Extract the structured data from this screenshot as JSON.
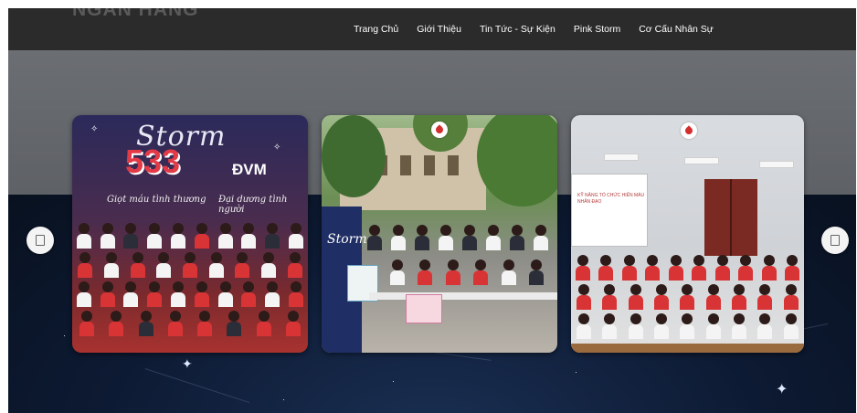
{
  "header": {
    "logo_text": "NGÂN HÀNG",
    "nav": [
      {
        "label": "Trang Chủ"
      },
      {
        "label": "Giới Thiệu"
      },
      {
        "label": "Tin Tức - Sự Kiện"
      },
      {
        "label": "Pink Storm"
      },
      {
        "label": "Cơ Cấu Nhân Sự"
      }
    ]
  },
  "carousel": {
    "slides": [
      {
        "storm_text": "Storm",
        "count": "533",
        "unit": "ĐVM",
        "subtitle_left": "Giọt máu tình thương",
        "subtitle_right": "Đại dương tình người"
      },
      {
        "banner_text": "Storm"
      },
      {
        "screen_text": "KỸ NĂNG TỔ CHỨC HIẾN MÁU NHÂN ĐẠO"
      }
    ],
    "prev_icon": "arrow-left-icon",
    "next_icon": "arrow-right-icon"
  },
  "colors": {
    "navbar": "#2b2b2b",
    "band_top": "#64676b",
    "band_bottom": "#0d1a33",
    "accent_red": "#e23a47"
  }
}
